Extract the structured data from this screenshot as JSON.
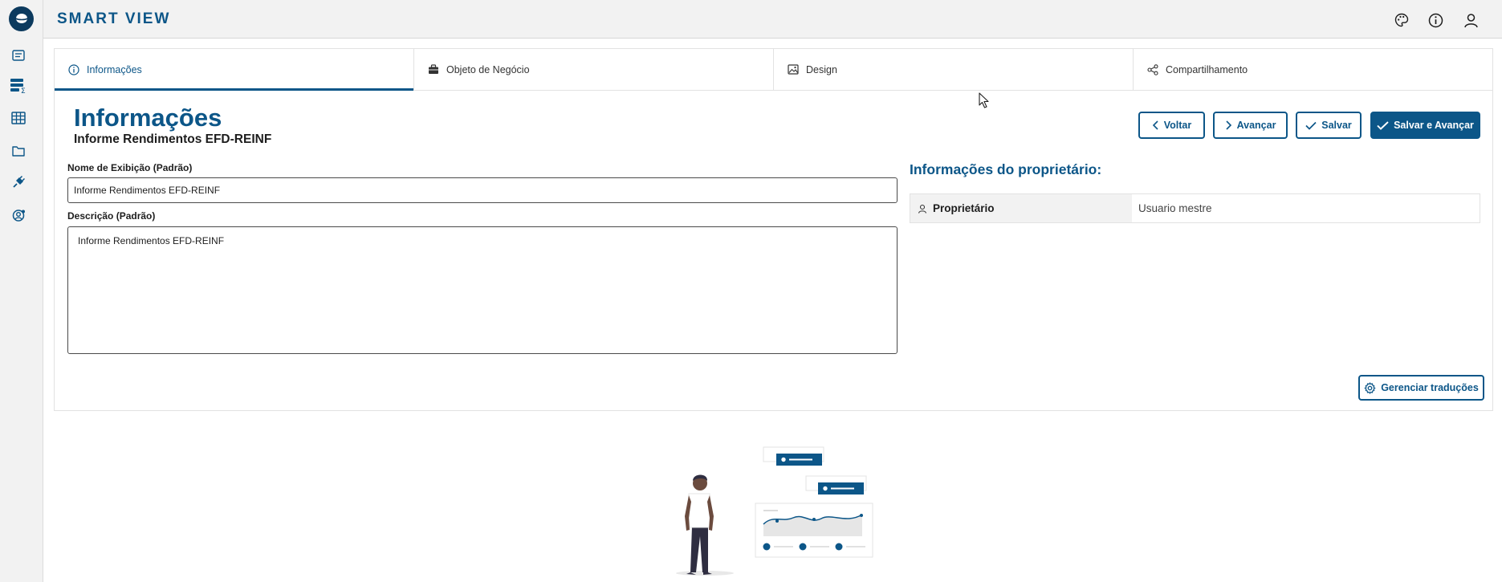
{
  "app": {
    "title": "SMART VIEW"
  },
  "sidebar": {
    "items": [
      {
        "icon": "list-document-icon"
      },
      {
        "icon": "list-sum-icon"
      },
      {
        "icon": "table-grid-icon"
      },
      {
        "icon": "folder-icon"
      },
      {
        "icon": "plug-icon"
      },
      {
        "icon": "user-settings-icon"
      }
    ]
  },
  "topbar": {
    "icons": [
      "palette-icon",
      "info-icon",
      "user-icon"
    ]
  },
  "tabs": [
    {
      "label": "Informações",
      "icon": "info-icon",
      "active": true
    },
    {
      "label": "Objeto de Negócio",
      "icon": "briefcase-icon",
      "active": false
    },
    {
      "label": "Design",
      "icon": "image-icon",
      "active": false
    },
    {
      "label": "Compartilhamento",
      "icon": "share-icon",
      "active": false
    }
  ],
  "page": {
    "title": "Informações",
    "subtitle": "Informe Rendimentos EFD-REINF"
  },
  "actions": {
    "back": "Voltar",
    "next": "Avançar",
    "save": "Salvar",
    "save_next": "Salvar e Avançar"
  },
  "form": {
    "display_name_label": "Nome de Exibição (Padrão)",
    "display_name_value": "Informe Rendimentos EFD-REINF",
    "description_label": "Descrição (Padrão)",
    "description_value": "Informe Rendimentos EFD-REINF"
  },
  "owner": {
    "title": "Informações do proprietário:",
    "key": "Proprietário",
    "value": "Usuario mestre"
  },
  "translations_button": "Gerenciar traduções",
  "colors": {
    "primary": "#0c5688",
    "sidebar_bg": "#f2f2f2",
    "logo": "#0c3a5e"
  }
}
